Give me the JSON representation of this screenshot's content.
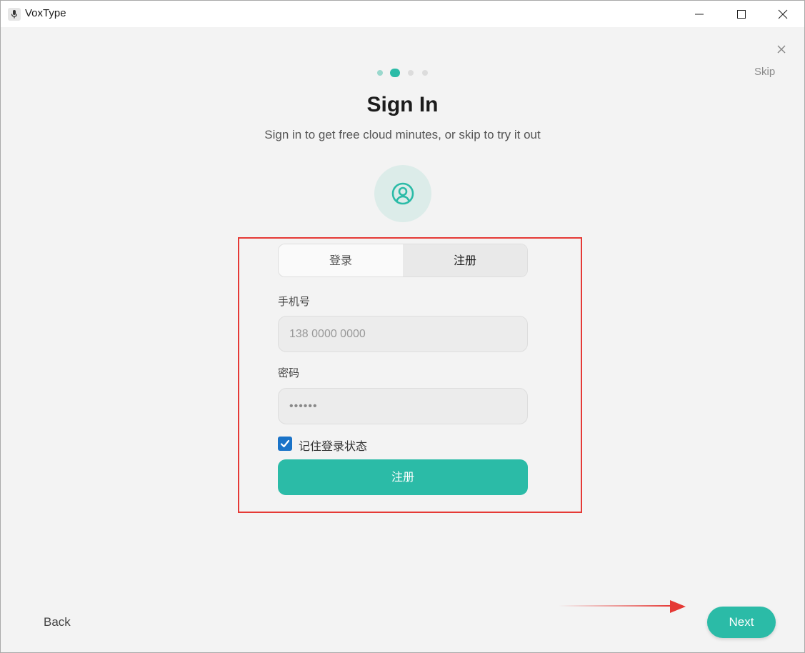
{
  "window": {
    "title": "VoxType",
    "icon": "microphone-icon",
    "controls": [
      "minimize-icon",
      "maximize-icon",
      "close-icon"
    ]
  },
  "onboarding": {
    "skip_label": "Skip",
    "close_icon": "close-icon",
    "steps_total": 4,
    "current_step": 2
  },
  "header": {
    "title": "Sign In",
    "subtitle": "Sign in to get free cloud minutes, or skip to try it out",
    "avatar_icon": "user-circle-icon"
  },
  "form": {
    "tabs": [
      {
        "label": "登录",
        "active": false
      },
      {
        "label": "注册",
        "active": true
      }
    ],
    "phone_label": "手机号",
    "phone_placeholder": "138 0000 0000",
    "password_label": "密码",
    "password_value": "••••••",
    "remember_label": "记住登录状态",
    "remember_checked": true,
    "submit_label": "注册"
  },
  "footer": {
    "back_label": "Back",
    "next_label": "Next"
  },
  "colors": {
    "accent": "#2bbba7",
    "annotation": "#e53935",
    "checkbox": "#1a73c8"
  }
}
